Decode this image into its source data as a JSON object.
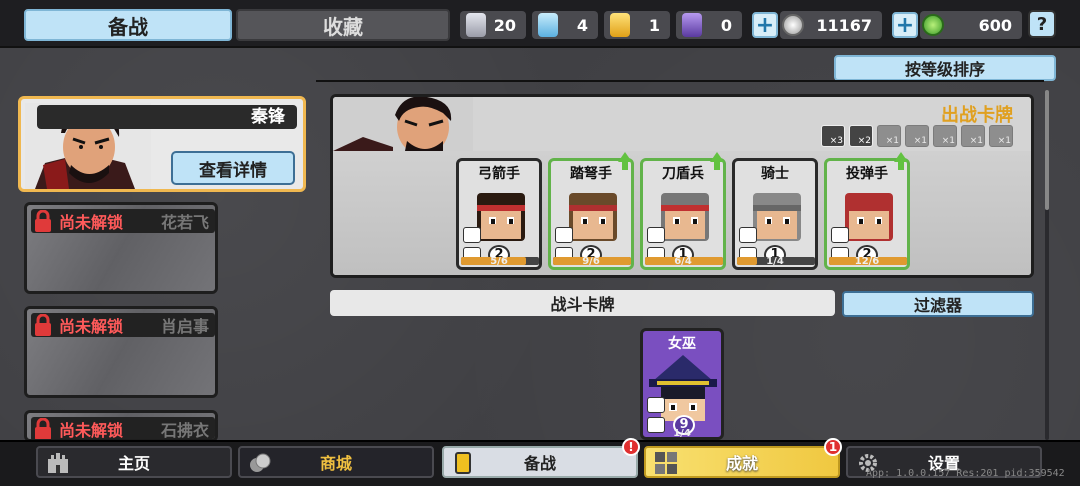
{
  "tabs": {
    "active": "备战",
    "inactive": "收藏"
  },
  "resources": [
    {
      "icon": "silver-shield-icon",
      "value": "20",
      "color": "#c9ccd6"
    },
    {
      "icon": "blue-gem-icon",
      "value": "4",
      "color": "#8fd0f0"
    },
    {
      "icon": "gold-shield-icon",
      "value": "1",
      "color": "#f0c030"
    },
    {
      "icon": "purple-gem-icon",
      "value": "0",
      "color": "#8a5ad0"
    }
  ],
  "currency": {
    "coins": "11167",
    "gems": "600"
  },
  "help": "?",
  "sort_button": "按等级排序",
  "hero": {
    "name": "秦锋",
    "detail_button": "查看详情"
  },
  "locked_heroes": [
    {
      "label": "尚未解锁",
      "name": "花若飞"
    },
    {
      "label": "尚未解锁",
      "name": "肖启事"
    },
    {
      "label": "尚未解锁",
      "name": "石拂衣"
    }
  ],
  "deck": {
    "title": "出战卡牌",
    "type_counts": [
      {
        "icon": "sword-type-icon",
        "count": "×3",
        "active": true
      },
      {
        "icon": "helmet-type-icon",
        "count": "×2",
        "active": true
      },
      {
        "icon": "horse-type-icon",
        "count": "×1",
        "active": false
      },
      {
        "icon": "spear-type-icon",
        "count": "×1",
        "active": false
      },
      {
        "icon": "shield-type-icon",
        "count": "×1",
        "active": false
      },
      {
        "icon": "skull-type-icon",
        "count": "×1",
        "active": false
      },
      {
        "icon": "mask-type-icon",
        "count": "×1",
        "active": false
      }
    ],
    "cards": [
      {
        "name": "弓箭手",
        "level": "2",
        "progress": "5/6",
        "fraction": 0.83,
        "upgradable": false,
        "hair": "#2a1a10",
        "band": "#c03030"
      },
      {
        "name": "踏弩手",
        "level": "2",
        "progress": "9/6",
        "fraction": 1.0,
        "upgradable": true,
        "hair": "#6a4a2a",
        "band": "#b03030"
      },
      {
        "name": "刀盾兵",
        "level": "1",
        "progress": "6/4",
        "fraction": 1.0,
        "upgradable": true,
        "hair": "#777",
        "band": "#c03030"
      },
      {
        "name": "骑士",
        "level": "1",
        "progress": "1/4",
        "fraction": 0.25,
        "upgradable": false,
        "hair": "#888",
        "band": "#666"
      },
      {
        "name": "投弹手",
        "level": "2",
        "progress": "12/6",
        "fraction": 1.0,
        "upgradable": true,
        "hair": "#b03030",
        "band": "#b03030"
      }
    ]
  },
  "battle_cards": {
    "title": "战斗卡牌",
    "filter": "过滤器",
    "cards": [
      {
        "name": "女巫",
        "level": "9",
        "progress": "1/4"
      }
    ]
  },
  "nav": [
    {
      "label": "主页",
      "icon": "castle-icon",
      "style": "dark"
    },
    {
      "label": "商城",
      "icon": "coins-icon",
      "style": "dark-gold"
    },
    {
      "label": "备战",
      "icon": "cards-icon",
      "style": "light",
      "badge": "!"
    },
    {
      "label": "成就",
      "icon": "achievement-icon",
      "style": "gold",
      "badge": "1"
    },
    {
      "label": "设置",
      "icon": "gear-icon",
      "style": "dark"
    }
  ],
  "version": "App: 1.0.0.157 Res:201 pid:359542"
}
